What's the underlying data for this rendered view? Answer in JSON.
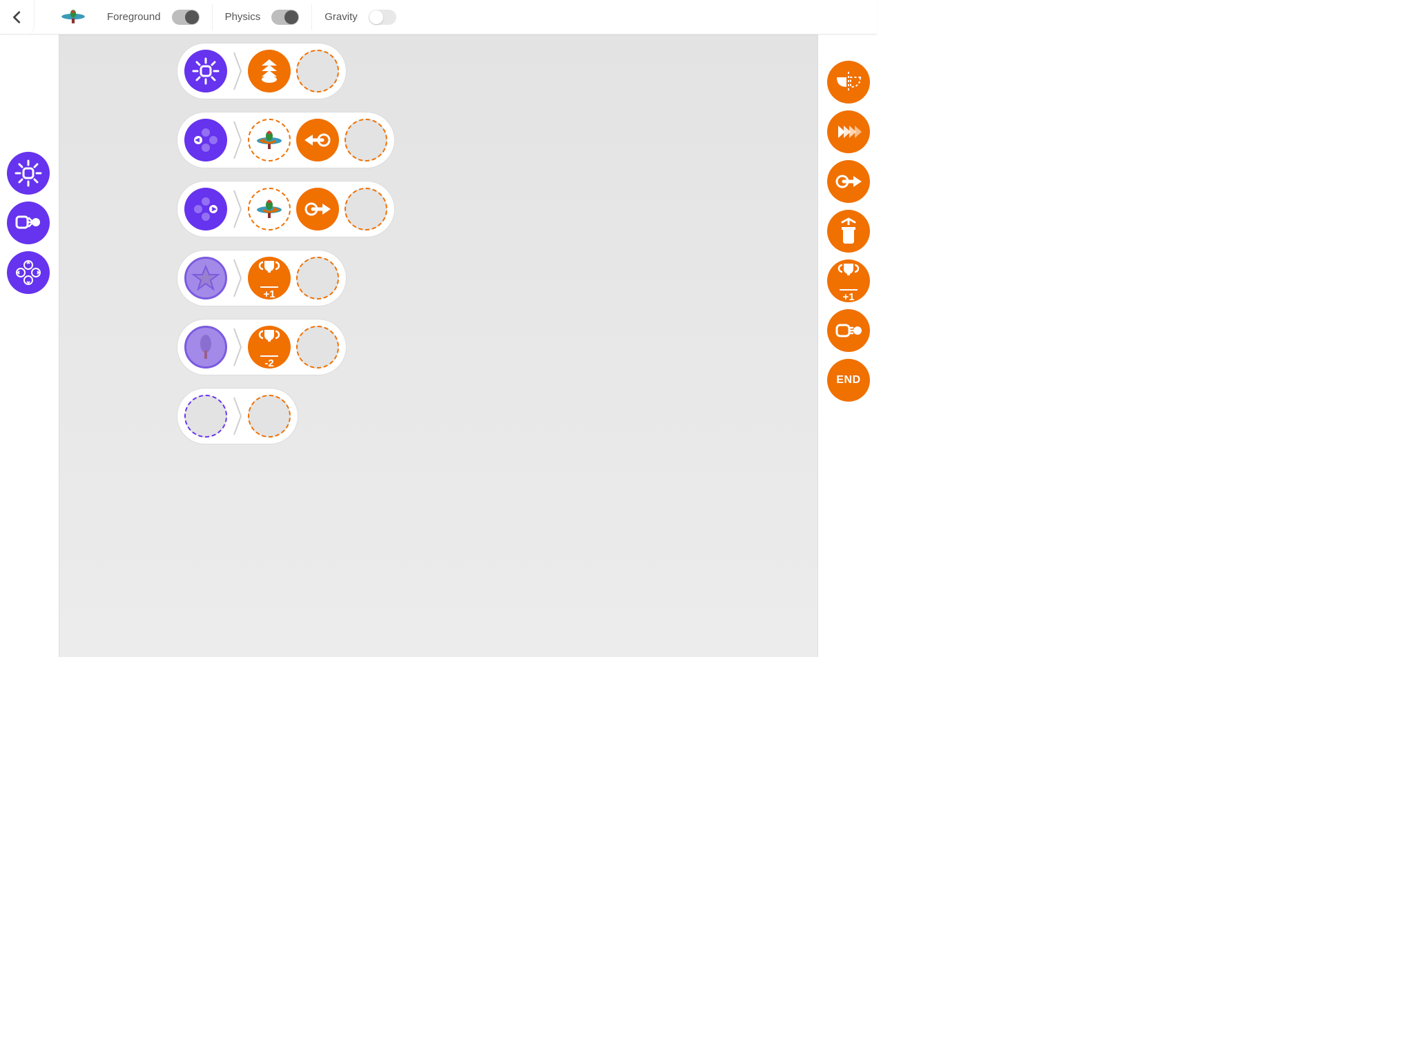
{
  "header": {
    "toggles": [
      {
        "label": "Foreground",
        "on": true
      },
      {
        "label": "Physics",
        "on": true
      },
      {
        "label": "Gravity",
        "on": false
      }
    ]
  },
  "palette_left": [
    {
      "id": "event-start",
      "name": "start-event-icon"
    },
    {
      "id": "event-collide",
      "name": "collision-event-icon"
    },
    {
      "id": "event-dpad",
      "name": "dpad-event-icon"
    }
  ],
  "palette_right": [
    {
      "id": "action-flip",
      "name": "flip-icon"
    },
    {
      "id": "action-speed",
      "name": "speed-burst-icon"
    },
    {
      "id": "action-move-r",
      "name": "move-right-icon"
    },
    {
      "id": "action-trash",
      "name": "trash-icon"
    },
    {
      "id": "action-score+1",
      "name": "trophy-plus1-icon",
      "score": "+1"
    },
    {
      "id": "action-shoot",
      "name": "emit-projectile-icon"
    },
    {
      "id": "action-end",
      "name": "end-label",
      "text": "END"
    }
  ],
  "rules": [
    {
      "when": {
        "kind": "start"
      },
      "then": [
        {
          "kind": "chevrons-up"
        },
        {
          "kind": "slot"
        }
      ]
    },
    {
      "when": {
        "kind": "dpad",
        "dir": "left"
      },
      "then": [
        {
          "kind": "sprite-dir",
          "dir": "left"
        },
        {
          "kind": "move",
          "dir": "left"
        },
        {
          "kind": "slot"
        }
      ]
    },
    {
      "when": {
        "kind": "dpad",
        "dir": "right"
      },
      "then": [
        {
          "kind": "sprite-dir",
          "dir": "right"
        },
        {
          "kind": "move",
          "dir": "right"
        },
        {
          "kind": "slot"
        }
      ]
    },
    {
      "when": {
        "kind": "collide",
        "with": "star"
      },
      "then": [
        {
          "kind": "score",
          "text": "+1"
        },
        {
          "kind": "slot"
        }
      ]
    },
    {
      "when": {
        "kind": "collide",
        "with": "tree"
      },
      "then": [
        {
          "kind": "score",
          "text": "-2"
        },
        {
          "kind": "slot"
        }
      ]
    },
    {
      "when": {
        "kind": "slot"
      },
      "then": [
        {
          "kind": "slot"
        }
      ]
    }
  ]
}
